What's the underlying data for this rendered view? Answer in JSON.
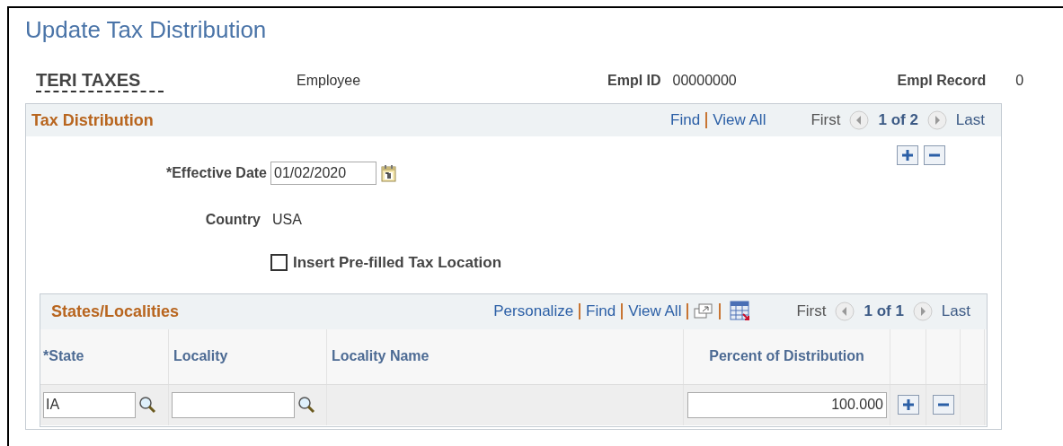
{
  "page_title": "Update Tax Distribution",
  "employee": {
    "name": "TERI TAXES",
    "type": "Employee",
    "empl_id_label": "Empl ID",
    "empl_id": "00000000",
    "empl_record_label": "Empl Record",
    "empl_record": "0"
  },
  "tax_distribution": {
    "title": "Tax Distribution",
    "links": [
      "Find",
      "View All"
    ],
    "nav": {
      "first": "First",
      "position": "1 of 2",
      "last": "Last"
    },
    "effective_date": {
      "label": "*Effective Date",
      "value": "01/02/2020"
    },
    "country": {
      "label": "Country",
      "value": "USA"
    },
    "prefilled": {
      "label": "Insert Pre-filled Tax Location",
      "checked": false
    },
    "states_grid": {
      "title": "States/Localities",
      "links": [
        "Personalize",
        "Find",
        "View All"
      ],
      "nav": {
        "first": "First",
        "position": "1 of 1",
        "last": "Last"
      },
      "columns": [
        "*State",
        "Locality",
        "Locality Name",
        "Percent of Distribution"
      ],
      "rows": [
        {
          "state": "IA",
          "locality": "",
          "percent": "100.000"
        }
      ]
    }
  }
}
